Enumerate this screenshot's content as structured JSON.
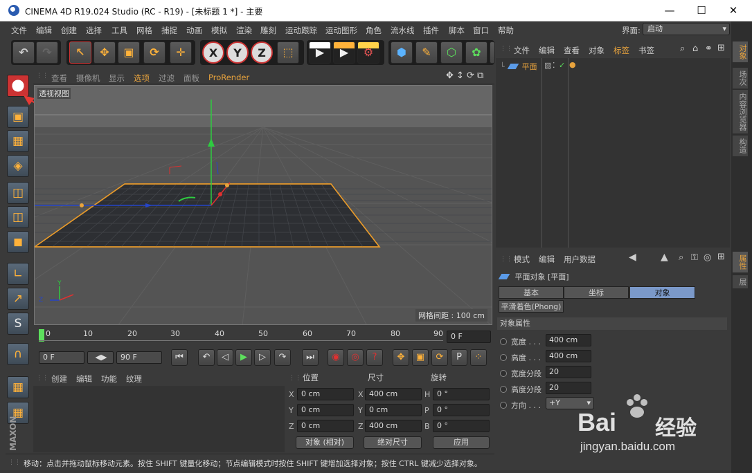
{
  "window": {
    "title": "CINEMA 4D R19.024 Studio (RC - R19) - [未标题 1 *] - 主要",
    "minimize": "—",
    "maximize": "☐",
    "close": "✕"
  },
  "menu": {
    "items": [
      "文件",
      "编辑",
      "创建",
      "选择",
      "工具",
      "网格",
      "捕捉",
      "动画",
      "模拟",
      "渲染",
      "雕刻",
      "运动跟踪",
      "运动图形",
      "角色",
      "流水线",
      "插件",
      "脚本",
      "窗口",
      "帮助"
    ],
    "interface_label": "界面:",
    "interface_value": "启动"
  },
  "toolbar": {
    "undo": "↶",
    "redo": "↷",
    "select": "↖",
    "move": "✥",
    "scale": "▣",
    "rotate": "⟳",
    "add": "✛",
    "x": "X",
    "y": "Y",
    "z": "Z",
    "coord": "⬚",
    "render_view": "▶",
    "render_pic": "▶",
    "render_settings": "⚙",
    "cube": "⬢",
    "pen": "✎",
    "subdiv": "⬡",
    "array": "✿",
    "light": "✦"
  },
  "viewport": {
    "menu": [
      "查看",
      "摄像机",
      "显示",
      "选项",
      "过滤",
      "面板",
      "ProRender"
    ],
    "active": "选项",
    "label": "透视视图",
    "grid_spacing": "网格间距 : 100 cm",
    "nav_icons": "✥ ↕ ⟳ ⧉"
  },
  "timeline": {
    "ticks": [
      "0",
      "10",
      "20",
      "30",
      "40",
      "50",
      "60",
      "70",
      "80",
      "90"
    ],
    "current_frame": "0 F"
  },
  "transport": {
    "start": "0 F",
    "end": "90 F",
    "arrows": "◀▶"
  },
  "materials": {
    "menu": [
      "创建",
      "编辑",
      "功能",
      "纹理"
    ]
  },
  "coords": {
    "headers": [
      "位置",
      "尺寸",
      "旋转"
    ],
    "rows": [
      {
        "axis": "X",
        "pos": "0 cm",
        "saxis": "X",
        "size": "400 cm",
        "raxis": "H",
        "rot": "0 °"
      },
      {
        "axis": "Y",
        "pos": "0 cm",
        "saxis": "Y",
        "size": "0 cm",
        "raxis": "P",
        "rot": "0 °"
      },
      {
        "axis": "Z",
        "pos": "0 cm",
        "saxis": "Z",
        "size": "400 cm",
        "raxis": "B",
        "rot": "0 °"
      }
    ],
    "mode": "对象 (相对)",
    "size_mode": "绝对尺寸",
    "apply": "应用"
  },
  "objects": {
    "menu": [
      "文件",
      "编辑",
      "查看",
      "对象",
      "标签",
      "书签"
    ],
    "active": "标签",
    "items": [
      {
        "name": "平面"
      }
    ]
  },
  "attributes": {
    "menu": [
      "模式",
      "编辑",
      "用户数据"
    ],
    "title": "平面对象 [平面]",
    "tabs": [
      "基本",
      "坐标",
      "对象"
    ],
    "active_tab": "对象",
    "phong": "平滑着色(Phong)",
    "section": "对象属性",
    "props": [
      {
        "label": "宽度 . . .",
        "value": "400 cm"
      },
      {
        "label": "高度 . . .",
        "value": "400 cm"
      },
      {
        "label": "宽度分段",
        "value": "20"
      },
      {
        "label": "高度分段",
        "value": "20"
      },
      {
        "label": "方向 . . .",
        "value": "+Y"
      }
    ]
  },
  "right_tabs": [
    "对象",
    "场次",
    "内容浏览器",
    "构造"
  ],
  "right_tabs2": [
    "属性",
    "层"
  ],
  "status": "移动：点击并拖动鼠标移动元素。按住 SHIFT 键量化移动；节点编辑模式时按住 SHIFT 键增加选择对象；按住 CTRL 键减少选择对象。",
  "watermark": {
    "brand": "Bai",
    "brand2": "经验",
    "url": "jingyan.baidu.com"
  }
}
